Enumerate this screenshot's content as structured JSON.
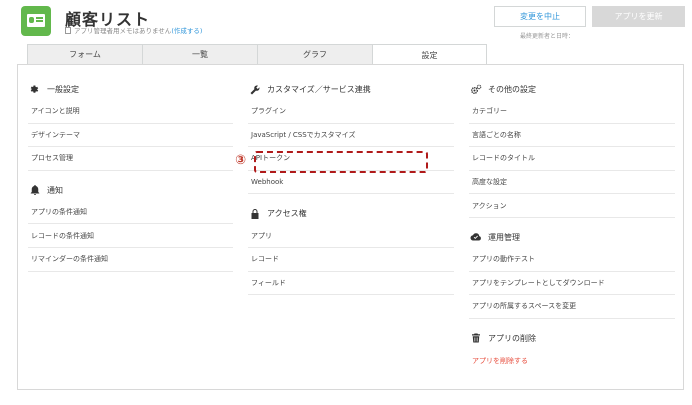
{
  "header": {
    "title": "顧客リスト",
    "memo_text": "アプリ管理者用メモはありません",
    "memo_link": "(作成する)",
    "cancel_label": "変更を中止",
    "update_label": "アプリを更新",
    "last_updated": "最終更新者と日時："
  },
  "tabs": [
    "フォーム",
    "一覧",
    "グラフ",
    "設定"
  ],
  "active_tab": "設定",
  "sections": {
    "general": {
      "title": "一般設定",
      "icon": "gear-icon",
      "items": [
        "アイコンと説明",
        "デザインテーマ",
        "プロセス管理"
      ]
    },
    "notifications": {
      "title": "通知",
      "icon": "bell-icon",
      "items": [
        "アプリの条件通知",
        "レコードの条件通知",
        "リマインダーの条件通知"
      ]
    },
    "customize": {
      "title": "カスタマイズ／サービス連携",
      "icon": "wrench-icon",
      "items": [
        "プラグイン",
        "JavaScript / CSSでカスタマイズ",
        "APIトークン",
        "Webhook"
      ]
    },
    "access": {
      "title": "アクセス権",
      "icon": "lock-icon",
      "items": [
        "アプリ",
        "レコード",
        "フィールド"
      ]
    },
    "other": {
      "title": "その他の設定",
      "icon": "gears-icon",
      "items": [
        "カテゴリー",
        "言語ごとの名称",
        "レコードのタイトル",
        "高度な設定",
        "アクション"
      ]
    },
    "operations": {
      "title": "運用管理",
      "icon": "cloud-icon",
      "items": [
        "アプリの動作テスト",
        "アプリをテンプレートとしてダウンロード",
        "アプリの所属するスペースを変更"
      ]
    },
    "delete": {
      "title": "アプリの削除",
      "icon": "trash-icon",
      "items": [
        "アプリを削除する"
      ]
    }
  },
  "annotation": {
    "step": "③"
  },
  "colors": {
    "brand_green": "#62b84c",
    "link_blue": "#3498db",
    "danger_red": "#e74c3c",
    "highlight": "#b01a1a"
  }
}
